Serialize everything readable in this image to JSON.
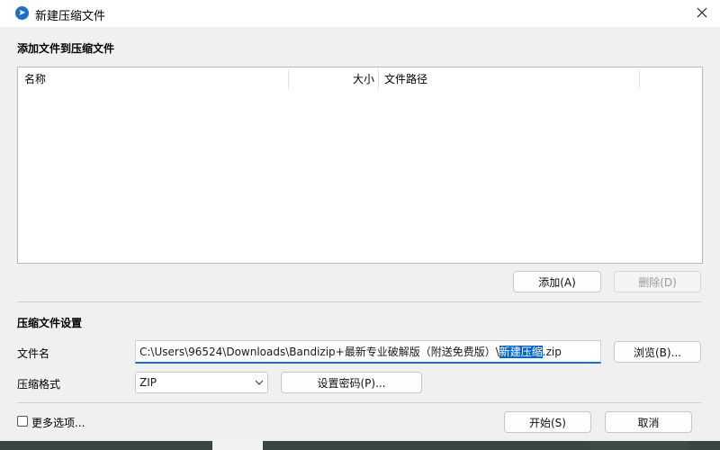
{
  "window": {
    "title": "新建压缩文件"
  },
  "add_section": {
    "heading": "添加文件到压缩文件",
    "columns": {
      "name": "名称",
      "size": "大小",
      "path": "文件路径"
    },
    "add_button": "添加(A)",
    "remove_button": "删除(D)"
  },
  "settings": {
    "heading": "压缩文件设置",
    "filename_label": "文件名",
    "filename_prefix": "C:\\Users\\96524\\Downloads\\Bandizip+最新专业破解版（附送免费版）\\",
    "filename_selected": "新建压缩",
    "filename_suffix": ".zip",
    "browse_button": "浏览(B)...",
    "format_label": "压缩格式",
    "format_value": "ZIP",
    "password_button": "设置密码(P)..."
  },
  "footer": {
    "more_options": "更多选项...",
    "start_button": "开始(S)",
    "cancel_button": "取消"
  },
  "colors": {
    "accent": "#0a64c9",
    "dialog_bg": "#f0f0f0"
  }
}
